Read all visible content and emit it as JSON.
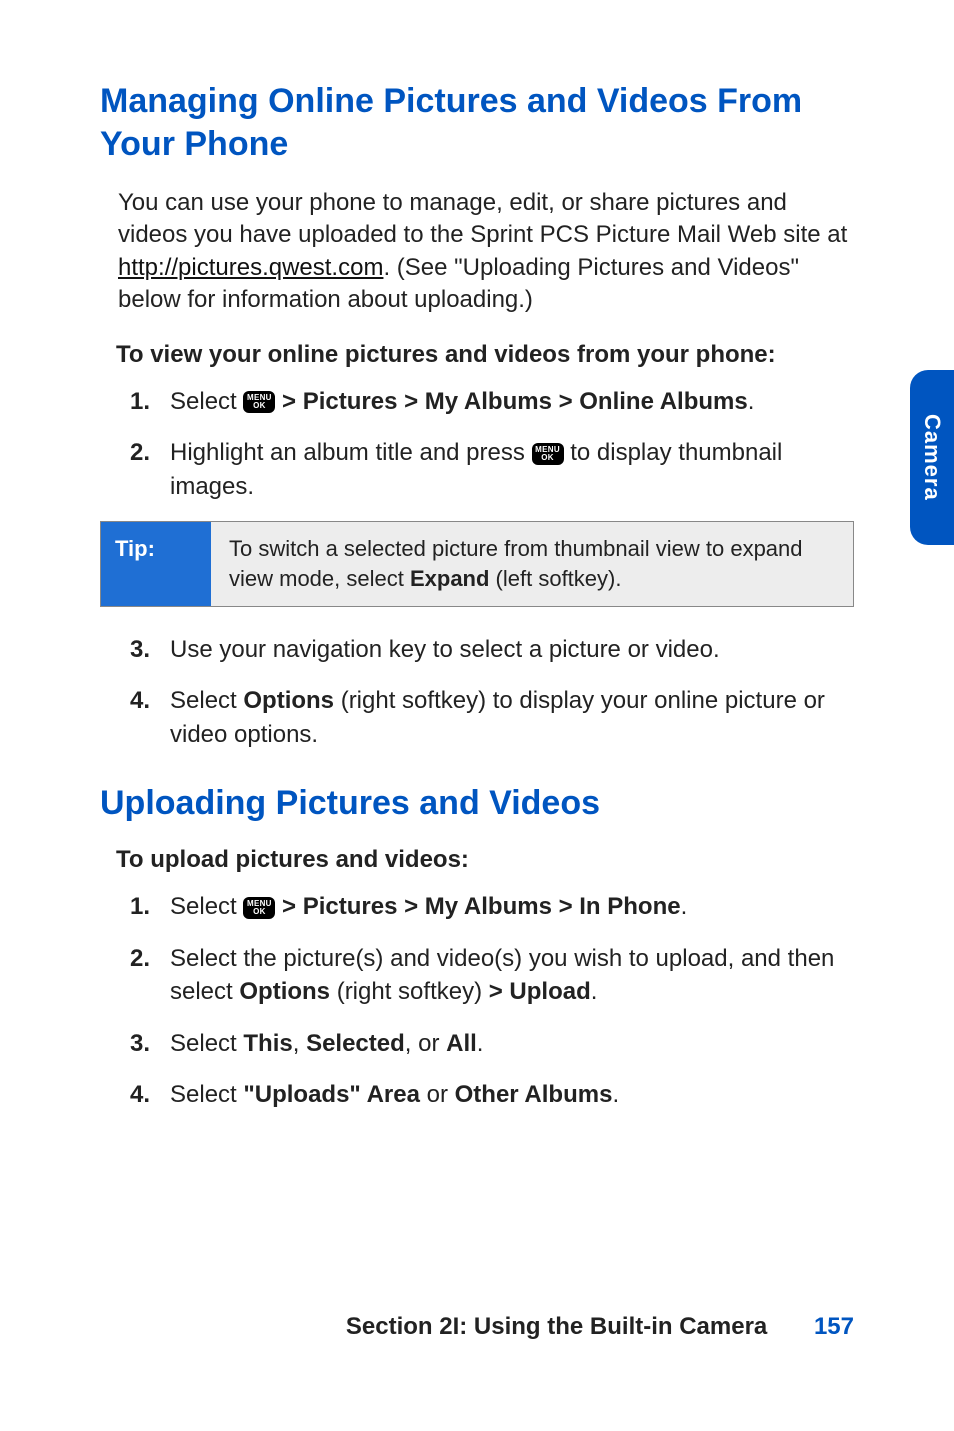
{
  "heading1": "Managing Online Pictures and Videos From Your Phone",
  "intro": {
    "part1": "You can use your phone to manage, edit, or share pictures and videos you have uploaded to the Sprint PCS Picture Mail Web site at ",
    "link": "http://pictures.qwest.com",
    "part2": ". (See \"Uploading Pictures and Videos\" below for information about uploading.)"
  },
  "instr_header1": "To view your online pictures and videos from your phone:",
  "menu_ok": {
    "line1": "MENU",
    "line2": "OK"
  },
  "section1_steps": {
    "s1": {
      "num": "1.",
      "pre": "Select ",
      "post": " > Pictures > My Albums > Online Albums",
      "end": "."
    },
    "s2": {
      "num": "2.",
      "pre": "Highlight an album title and press ",
      "post": " to display thumbnail images."
    },
    "s3": {
      "num": "3.",
      "text": "Use your navigation key to select a picture or video."
    },
    "s4": {
      "num": "4.",
      "pre": "Select ",
      "boldA": "Options",
      "post": " (right softkey) to display your online picture or video options."
    }
  },
  "tip": {
    "label": "Tip:",
    "pre": "To switch a selected picture from thumbnail view to expand view mode, select ",
    "bold": "Expand",
    "post": " (left softkey)."
  },
  "heading2": "Uploading Pictures and Videos",
  "instr_header2": "To upload pictures and videos:",
  "section2_steps": {
    "s1": {
      "num": "1.",
      "pre": "Select ",
      "post": " > Pictures > My Albums > In Phone",
      "end": "."
    },
    "s2": {
      "num": "2.",
      "pre": "Select the picture(s) and video(s) you wish to upload, and then select ",
      "boldA": "Options",
      "mid": " (right softkey) ",
      "boldB": "> Upload",
      "end": "."
    },
    "s3": {
      "num": "3.",
      "pre": "Select ",
      "boldA": "This",
      "sep1": ", ",
      "boldB": "Selected",
      "sep2": ", or ",
      "boldC": "All",
      "end": "."
    },
    "s4": {
      "num": "4.",
      "pre": "Select ",
      "boldA": "\"Uploads\" Area",
      "mid": " or ",
      "boldB": "Other Albums",
      "end": "."
    }
  },
  "side_tab": "Camera",
  "footer": {
    "section": "Section 2I: Using the Built-in Camera",
    "page": "157"
  }
}
